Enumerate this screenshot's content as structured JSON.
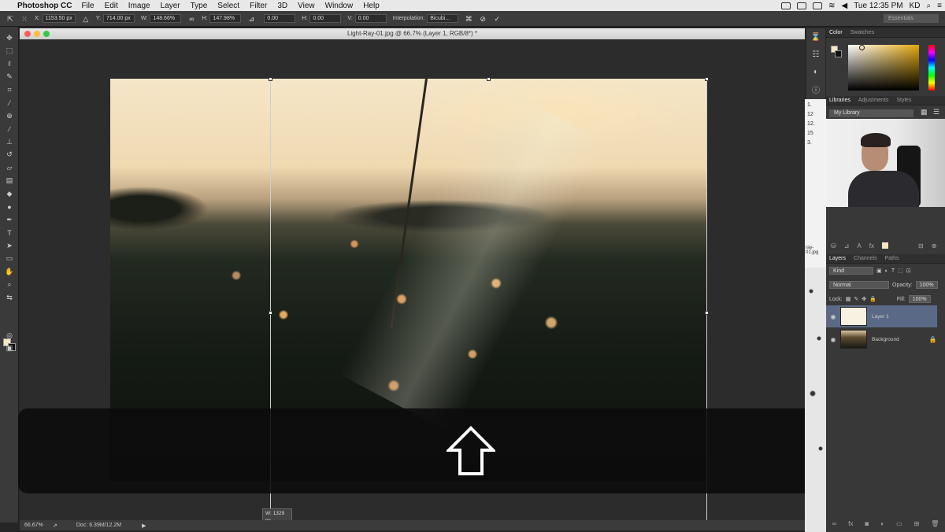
{
  "menubar": {
    "app_name": "Photoshop CC",
    "items": [
      "File",
      "Edit",
      "Image",
      "Layer",
      "Type",
      "Select",
      "Filter",
      "3D",
      "View",
      "Window",
      "Help"
    ],
    "clock": "Tue 12:35 PM",
    "user": "KD"
  },
  "options_bar": {
    "x_label": "X:",
    "x_value": "1153.50 px",
    "y_label": "Y:",
    "y_value": "714.00 px",
    "w_label": "W:",
    "w_value": "148.66%",
    "h_label": "H:",
    "h_value": "147.98%",
    "angle_value": "0.00",
    "hskew_label": "H:",
    "hskew_value": "0.00",
    "vskew_label": "V:",
    "vskew_value": "0.00",
    "interp_label": "Interpolation:",
    "interp_value": "Bicubi...",
    "workspace": "Essentials"
  },
  "document": {
    "title": "Light-Ray-01.jpg @ 66.7% (Layer 1, RGB/8*) *"
  },
  "transform_tip": {
    "w": "W: 1329 px",
    "h": "H: 1428 px"
  },
  "statusbar": {
    "zoom": "66.67%",
    "doc": "Doc: 6.39M/12.2M"
  },
  "color_panel": {
    "tabs": [
      "Color",
      "Swatches"
    ],
    "fg_color": "#f4e7c4",
    "bg_color": "#111111"
  },
  "libraries_panel": {
    "tabs": [
      "Libraries",
      "Adjustments",
      "Styles"
    ],
    "library": "My Library",
    "behind_text": [
      "1.",
      "12",
      "12.",
      "15",
      "3."
    ],
    "behind_file": "ray-01.jpg"
  },
  "layers_panel": {
    "tabs": [
      "Layers",
      "Channels",
      "Paths"
    ],
    "kind": "Kind",
    "blend_mode": "Normal",
    "opacity_label": "Opacity:",
    "opacity": "100%",
    "lock_label": "Lock:",
    "fill_label": "Fill:",
    "fill": "100%",
    "layers": [
      {
        "name": "Layer 1",
        "selected": true
      },
      {
        "name": "Background",
        "selected": false
      }
    ]
  }
}
